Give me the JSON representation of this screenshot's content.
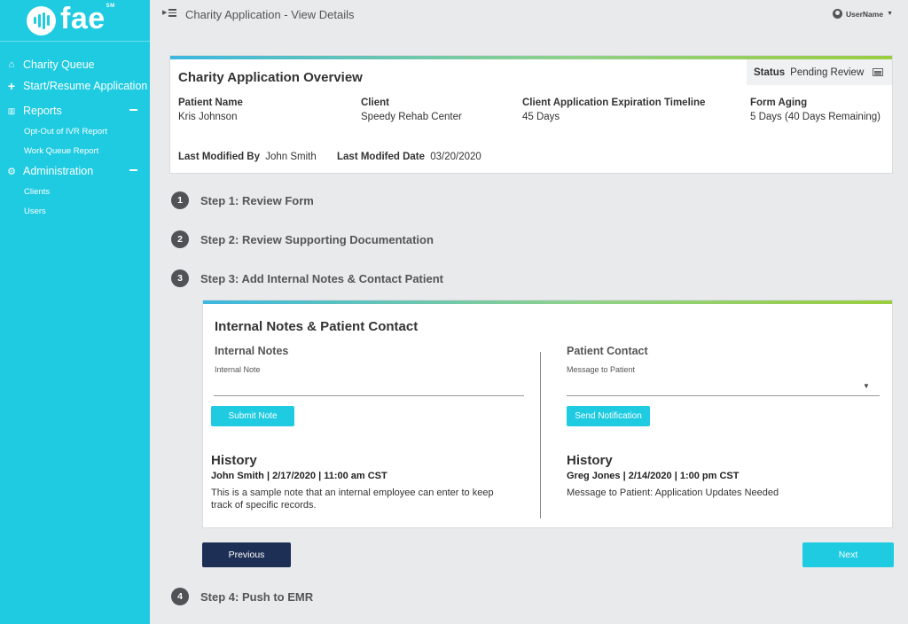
{
  "brand": {
    "name": "fae",
    "tm": "SM"
  },
  "sidebar": {
    "items": [
      {
        "label": "Charity Queue",
        "icon": "home-icon"
      },
      {
        "label": "Start/Resume Application",
        "icon": "plus-icon"
      },
      {
        "label": "Reports",
        "icon": "chart-icon",
        "sub": [
          "Opt-Out of IVR Report",
          "Work Queue Report"
        ]
      },
      {
        "label": "Administration",
        "icon": "gear-icon",
        "sub": [
          "Clients",
          "Users"
        ]
      }
    ]
  },
  "header": {
    "title": "Charity Application - View Details",
    "username": "UserName"
  },
  "overview": {
    "title": "Charity Application Overview",
    "status_label": "Status",
    "status_value": "Pending Review",
    "fields": [
      {
        "label": "Patient Name",
        "value": "Kris Johnson"
      },
      {
        "label": "Client",
        "value": "Speedy Rehab Center"
      },
      {
        "label": "Client Application Expiration Timeline",
        "value": "45 Days"
      },
      {
        "label": "Form Aging",
        "value": "5 Days (40 Days Remaining)"
      }
    ],
    "last_modified_by_label": "Last Modified By",
    "last_modified_by": "John Smith",
    "last_modified_date_label": "Last Modifed Date",
    "last_modified_date": "03/20/2020"
  },
  "steps": [
    {
      "num": "1",
      "label": "Step 1: Review Form"
    },
    {
      "num": "2",
      "label": "Step 2: Review Supporting Documentation"
    },
    {
      "num": "3",
      "label": "Step 3: Add Internal Notes & Contact Patient"
    },
    {
      "num": "4",
      "label": "Step 4: Push to EMR"
    }
  ],
  "notes_panel": {
    "title": "Internal Notes & Patient Contact",
    "internal": {
      "heading": "Internal Notes",
      "field_label": "Internal Note",
      "value": "",
      "button": "Submit Note",
      "history_heading": "History",
      "history_meta": "John Smith | 2/17/2020 | 11:00 am CST",
      "history_text_1": "This is a sample note that an internal employee can enter to keep",
      "history_text_2": "track of specific records."
    },
    "contact": {
      "heading": "Patient Contact",
      "field_label": "Message to Patient",
      "value": "",
      "button": "Send Notification",
      "history_heading": "History",
      "history_meta": "Greg Jones | 2/14/2020 | 1:00 pm CST",
      "history_text": "Message to Patient: Application Updates Needed"
    }
  },
  "nav_buttons": {
    "previous": "Previous",
    "next": "Next"
  },
  "colors": {
    "sidebar": "#1ecbe1",
    "primary_dark": "#1e2f55",
    "accent": "#1ecbe1"
  }
}
